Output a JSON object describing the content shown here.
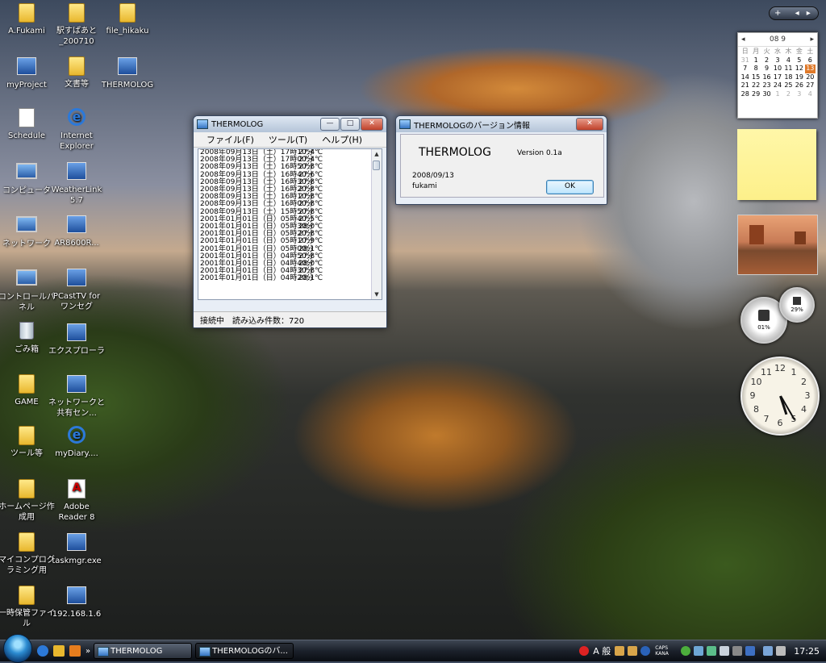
{
  "desktop_icons": [
    {
      "label": "A.Fukami",
      "kind": "folder"
    },
    {
      "label": "駅すぱあと_200710",
      "kind": "folder"
    },
    {
      "label": "file_hikaku",
      "kind": "folder"
    },
    {
      "label": "myProject",
      "kind": "app"
    },
    {
      "label": "文書等",
      "kind": "folder"
    },
    {
      "label": "THERMOLOG",
      "kind": "app"
    },
    {
      "label": "Schedule",
      "kind": "doc"
    },
    {
      "label": "Internet Explorer",
      "kind": "ie"
    },
    {
      "label": "コンピュータ",
      "kind": "monitor"
    },
    {
      "label": "WeatherLink 5.7",
      "kind": "app"
    },
    {
      "label": "ネットワーク",
      "kind": "monitor"
    },
    {
      "label": "AR8600R...",
      "kind": "app"
    },
    {
      "label": "コントロールパネル",
      "kind": "monitor"
    },
    {
      "label": "PCastTV for ワンセグ",
      "kind": "app"
    },
    {
      "label": "ごみ箱",
      "kind": "trash"
    },
    {
      "label": "エクスプローラ",
      "kind": "app"
    },
    {
      "label": "GAME",
      "kind": "folder"
    },
    {
      "label": "ネットワークと共有セン...",
      "kind": "app"
    },
    {
      "label": "ツール等",
      "kind": "folder"
    },
    {
      "label": "myDiary....",
      "kind": "ie"
    },
    {
      "label": "ホームページ作成用",
      "kind": "folder"
    },
    {
      "label": "Adobe Reader 8",
      "kind": "pdf"
    },
    {
      "label": "マイコンプログラミング用",
      "kind": "folder"
    },
    {
      "label": "taskmgr.exe",
      "kind": "app"
    },
    {
      "label": "一時保管ファイル",
      "kind": "folder"
    },
    {
      "label": "192.168.1.6",
      "kind": "app"
    }
  ],
  "thermolog": {
    "title": "THERMOLOG",
    "menu": [
      "ファイル(F)",
      "ツール(T)",
      "ヘルプ(H)"
    ],
    "rows": [
      {
        "date": "2008年09月13日（土）17時10分",
        "temp": "27.4℃"
      },
      {
        "date": "2008年09月13日（土）17時00分",
        "temp": "27.4℃"
      },
      {
        "date": "2008年09月13日（土）16時50分",
        "temp": "27.8℃"
      },
      {
        "date": "2008年09月13日（土）16時40分",
        "temp": "27.6℃"
      },
      {
        "date": "2008年09月13日（土）16時30分",
        "temp": "27.8℃"
      },
      {
        "date": "2008年09月13日（土）16時20分",
        "temp": "27.8℃"
      },
      {
        "date": "2008年09月13日（土）16時10分",
        "temp": "27.8℃"
      },
      {
        "date": "2008年09月13日（土）16時00分",
        "temp": "27.8℃"
      },
      {
        "date": "2008年09月13日（土）15時50分",
        "temp": "27.8℃"
      },
      {
        "date": "2001年01月01日（日）05時40分",
        "temp": "27.5℃"
      },
      {
        "date": "2001年01月01日（日）05時30分",
        "temp": "28.0℃"
      },
      {
        "date": "2001年01月01日（日）05時20分",
        "temp": "27.8℃"
      },
      {
        "date": "2001年01月01日（日）05時10分",
        "temp": "27.9℃"
      },
      {
        "date": "2001年01月01日（日）05時00分",
        "temp": "28.1℃"
      },
      {
        "date": "2001年01月01日（日）04時50分",
        "temp": "27.8℃"
      },
      {
        "date": "2001年01月01日（日）04時40分",
        "temp": "28.0℃"
      },
      {
        "date": "2001年01月01日（日）04時30分",
        "temp": "27.8℃"
      },
      {
        "date": "2001年01月01日（日）04時20分",
        "temp": "28.1℃"
      }
    ],
    "status": "接続中　読み込み件数：720"
  },
  "about": {
    "title": "THERMOLOGのバージョン情報",
    "app_name": "THERMOLOG",
    "version": "Version 0.1a",
    "date": "2008/09/13",
    "author": "fukami",
    "ok_label": "OK"
  },
  "calendar": {
    "month": "08 9",
    "weekdays": [
      "日",
      "月",
      "火",
      "水",
      "木",
      "金",
      "土"
    ],
    "days": [
      {
        "d": "31",
        "o": true
      },
      {
        "d": "1"
      },
      {
        "d": "2"
      },
      {
        "d": "3"
      },
      {
        "d": "4"
      },
      {
        "d": "5"
      },
      {
        "d": "6"
      },
      {
        "d": "7"
      },
      {
        "d": "8"
      },
      {
        "d": "9"
      },
      {
        "d": "10"
      },
      {
        "d": "11"
      },
      {
        "d": "12"
      },
      {
        "d": "13",
        "t": true
      },
      {
        "d": "14"
      },
      {
        "d": "15"
      },
      {
        "d": "16"
      },
      {
        "d": "17"
      },
      {
        "d": "18"
      },
      {
        "d": "19"
      },
      {
        "d": "20"
      },
      {
        "d": "21"
      },
      {
        "d": "22"
      },
      {
        "d": "23"
      },
      {
        "d": "24"
      },
      {
        "d": "25"
      },
      {
        "d": "26"
      },
      {
        "d": "27"
      },
      {
        "d": "28"
      },
      {
        "d": "29"
      },
      {
        "d": "30"
      },
      {
        "d": "1",
        "o": true
      },
      {
        "d": "2",
        "o": true
      },
      {
        "d": "3",
        "o": true
      },
      {
        "d": "4",
        "o": true
      }
    ]
  },
  "meter": {
    "cpu": "01%",
    "mem": "29%"
  },
  "clock": {
    "numbers": [
      "12",
      "1",
      "2",
      "3",
      "4",
      "5",
      "6",
      "7",
      "8",
      "9",
      "10",
      "11"
    ],
    "hour": 5.4,
    "minute": 25
  },
  "taskbar": {
    "tasks": [
      "THERMOLOG",
      "THERMOLOGのバ..."
    ],
    "ime": "A 般",
    "caps": "CAPS KANA",
    "time": "17:25"
  },
  "sidebar_toolbar": {
    "plus": "+"
  }
}
